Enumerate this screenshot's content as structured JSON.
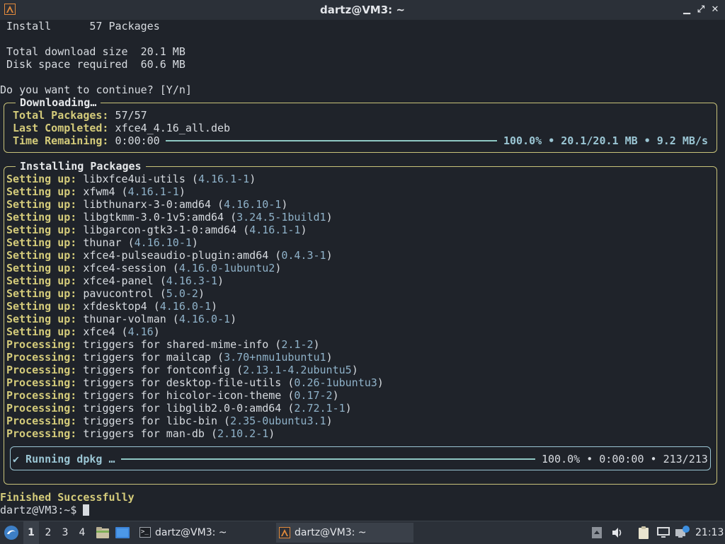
{
  "window": {
    "title": "dartz@VM3: ~",
    "minimize_glyph": "▁",
    "maximize_glyph": "⤢",
    "close_glyph": "✕"
  },
  "terminal": {
    "summary": [
      "Install      57 Packages",
      "",
      "Total download size  20.1 MB",
      "Disk space required  60.6 MB"
    ],
    "prompt_continue": "Do you want to continue? [Y/n]",
    "download": {
      "title": "Downloading…",
      "total_label": "Total Packages:",
      "total_value": "57/57",
      "last_label": "Last Completed:",
      "last_value": "xfce4_4.16_all.deb",
      "time_label": "Time Remaining:",
      "time_value": "0:00:00",
      "progress_fraction": 1.0,
      "stats": "100.0% • 20.1/20.1 MB • 9.2 MB/s"
    },
    "install": {
      "title": "Installing Packages",
      "rows": [
        {
          "label": "Setting up:",
          "text": "libxfce4ui-utils (",
          "ver": "4.16.1-1",
          "end": ")"
        },
        {
          "label": "Setting up:",
          "text": "xfwm4 (",
          "ver": "4.16.1-1",
          "end": ")"
        },
        {
          "label": "Setting up:",
          "text": "libthunarx-3-0:amd64 (",
          "ver": "4.16.10-1",
          "end": ")"
        },
        {
          "label": "Setting up:",
          "text": "libgtkmm-3.0-1v5:amd64 (",
          "ver": "3.24.5-1build1",
          "end": ")"
        },
        {
          "label": "Setting up:",
          "text": "libgarcon-gtk3-1-0:amd64 (",
          "ver": "4.16.1-1",
          "end": ")"
        },
        {
          "label": "Setting up:",
          "text": "thunar (",
          "ver": "4.16.10-1",
          "end": ")"
        },
        {
          "label": "Setting up:",
          "text": "xfce4-pulseaudio-plugin:amd64 (",
          "ver": "0.4.3-1",
          "end": ")"
        },
        {
          "label": "Setting up:",
          "text": "xfce4-session (",
          "ver": "4.16.0-1ubuntu2",
          "end": ")"
        },
        {
          "label": "Setting up:",
          "text": "xfce4-panel (",
          "ver": "4.16.3-1",
          "end": ")"
        },
        {
          "label": "Setting up:",
          "text": "pavucontrol (",
          "ver": "5.0-2",
          "end": ")"
        },
        {
          "label": "Setting up:",
          "text": "xfdesktop4 (",
          "ver": "4.16.0-1",
          "end": ")"
        },
        {
          "label": "Setting up:",
          "text": "thunar-volman (",
          "ver": "4.16.0-1",
          "end": ")"
        },
        {
          "label": "Setting up:",
          "text": "xfce4 (",
          "ver": "4.16",
          "end": ")"
        },
        {
          "label": "Processing:",
          "text": "triggers for shared-mime-info (",
          "ver": "2.1-2",
          "end": ")"
        },
        {
          "label": "Processing:",
          "text": "triggers for mailcap (",
          "ver": "3.70+nmu1ubuntu1",
          "end": ")"
        },
        {
          "label": "Processing:",
          "text": "triggers for fontconfig (",
          "ver": "2.13.1-4.2ubuntu5",
          "end": ")"
        },
        {
          "label": "Processing:",
          "text": "triggers for desktop-file-utils (",
          "ver": "0.26-1ubuntu3",
          "end": ")"
        },
        {
          "label": "Processing:",
          "text": "triggers for hicolor-icon-theme (",
          "ver": "0.17-2",
          "end": ")"
        },
        {
          "label": "Processing:",
          "text": "triggers for libglib2.0-0:amd64 (",
          "ver": "2.72.1-1",
          "end": ")"
        },
        {
          "label": "Processing:",
          "text": "triggers for libc-bin (",
          "ver": "2.35-0ubuntu3.1",
          "end": ")"
        },
        {
          "label": "Processing:",
          "text": "triggers for man-db (",
          "ver": "2.10.2-1",
          "end": ")"
        }
      ],
      "dpkg": {
        "label": "✔ Running dpkg …",
        "progress_fraction": 1.0,
        "stats": "100.0% • 0:00:00 • 213/213"
      }
    },
    "finished": "Finished Successfully",
    "prompt": "dartz@VM3:~$ "
  },
  "taskbar": {
    "workspaces": [
      "1",
      "2",
      "3",
      "4"
    ],
    "active_workspace": "1",
    "tasks": [
      {
        "label": "dartz@VM3: ~",
        "icon": "terminal-icon"
      },
      {
        "label": "dartz@VM3: ~",
        "icon": "alacritty-icon"
      }
    ],
    "clock": "21:13"
  }
}
